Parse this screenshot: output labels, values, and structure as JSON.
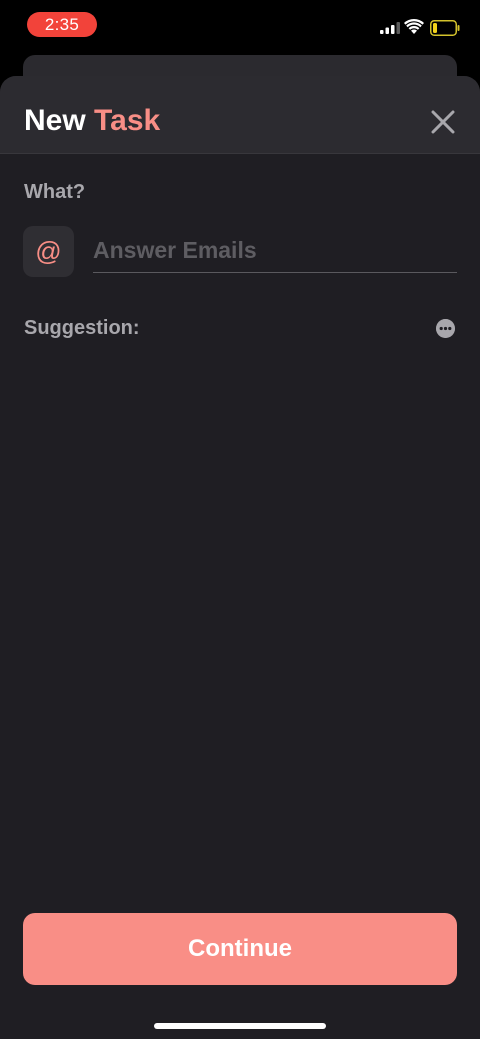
{
  "status_bar": {
    "time": "2:35",
    "time_pill_color": "#f2433a",
    "icons": [
      "cellular-signal-icon",
      "wifi-icon",
      "battery-low-icon"
    ]
  },
  "sheet": {
    "title_part1": "New",
    "title_part2": "Task",
    "accent_color": "#f88e86",
    "close_icon": "close-icon"
  },
  "form": {
    "what_label": "What?",
    "task_icon_glyph": "@",
    "task_input": {
      "value": "",
      "placeholder": "Answer Emails"
    },
    "suggestion_label": "Suggestion:",
    "more_icon": "more-options-icon"
  },
  "footer": {
    "continue_label": "Continue",
    "button_color": "#f98e86"
  }
}
